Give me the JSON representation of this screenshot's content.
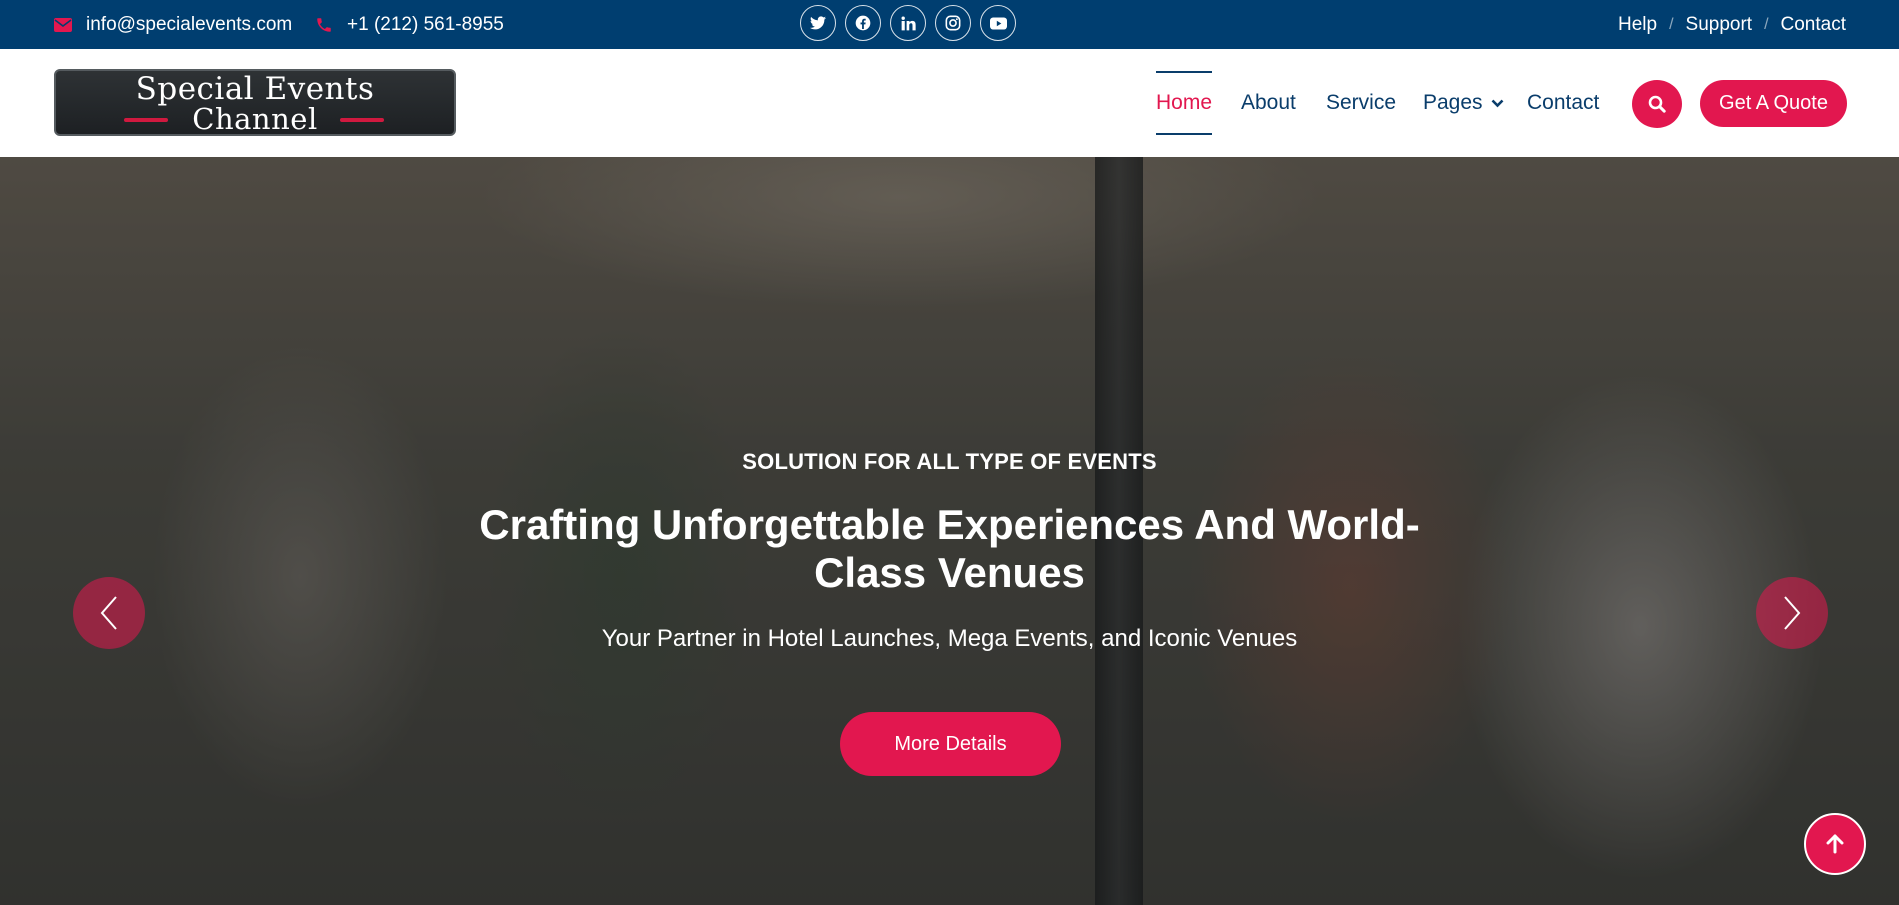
{
  "topbar": {
    "email": "info@specialevents.com",
    "phone": "+1 (212) 561-8955",
    "socials": [
      "twitter-icon",
      "facebook-icon",
      "linkedin-icon",
      "instagram-icon",
      "youtube-icon"
    ],
    "links": [
      "Help",
      "Support",
      "Contact"
    ],
    "separator": "/"
  },
  "logo": {
    "line1": "Special Events",
    "line2": "Channel"
  },
  "nav": {
    "items": [
      "Home",
      "About",
      "Service",
      "Pages",
      "Contact"
    ],
    "active": "Home",
    "quote_label": "Get A Quote"
  },
  "hero": {
    "eyebrow": "SOLUTION FOR ALL TYPE OF EVENTS",
    "title": "Crafting Unforgettable Experiences And World-Class Venues",
    "subtitle": "Your Partner in Hotel Launches, Mega Events, and Iconic Venues",
    "button_label": "More Details"
  },
  "colors": {
    "topbar": "#003e70",
    "accent": "#e2174f",
    "nav_text": "#0a3d6b"
  }
}
